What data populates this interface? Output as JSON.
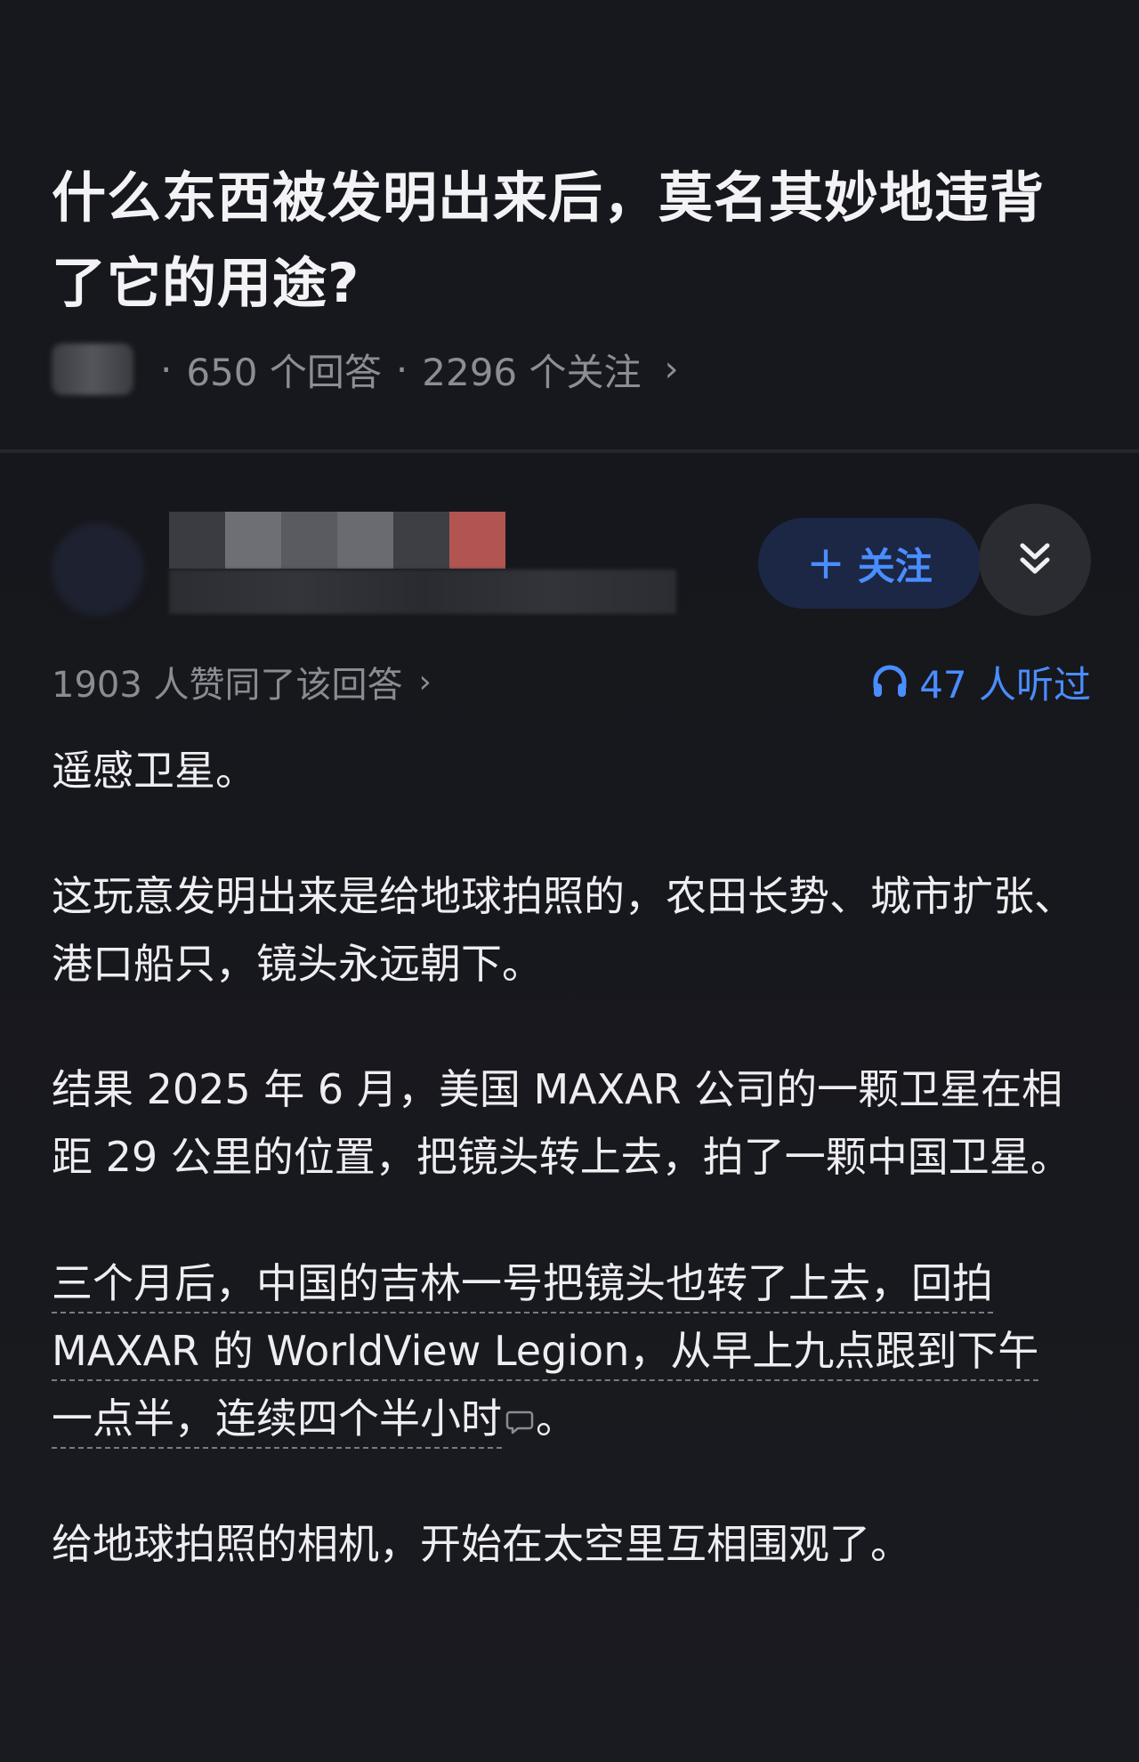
{
  "question": {
    "title": "什么东西被发明出来后，莫名其妙地违背了它的用途?",
    "answers_count": "650 个回答",
    "followers_count": "2296 个关注"
  },
  "answer": {
    "follow_label": "关注",
    "upvotes_text": "1903 人赞同了该回答",
    "listens_text": "47 人听过",
    "paragraphs": {
      "p1": "遥感卫星。",
      "p2": "这玩意发明出来是给地球拍照的，农田长势、城市扩张、港口船只，镜头永远朝下。",
      "p3": "结果 2025 年 6 月，美国 MAXAR 公司的一颗卫星在相距 29 公里的位置，把镜头转上去，拍了一颗中国卫星。",
      "p4": "三个月后，中国的吉林一号把镜头也转了上去，回拍 MAXAR 的 WorldView Legion，从早上九点跟到下午一点半，连续四个半小时",
      "p4_end": "。",
      "p5": "给地球拍照的相机，开始在太空里互相围观了。"
    }
  },
  "colors": {
    "background": "#131418",
    "accent_blue": "#4a8dff",
    "text_primary": "#eeeef0",
    "text_secondary": "#8b8c92"
  },
  "icons": {
    "collapse": "double-chevron-down-icon",
    "listen": "headphones-icon",
    "comment": "comment-bubble-icon"
  }
}
